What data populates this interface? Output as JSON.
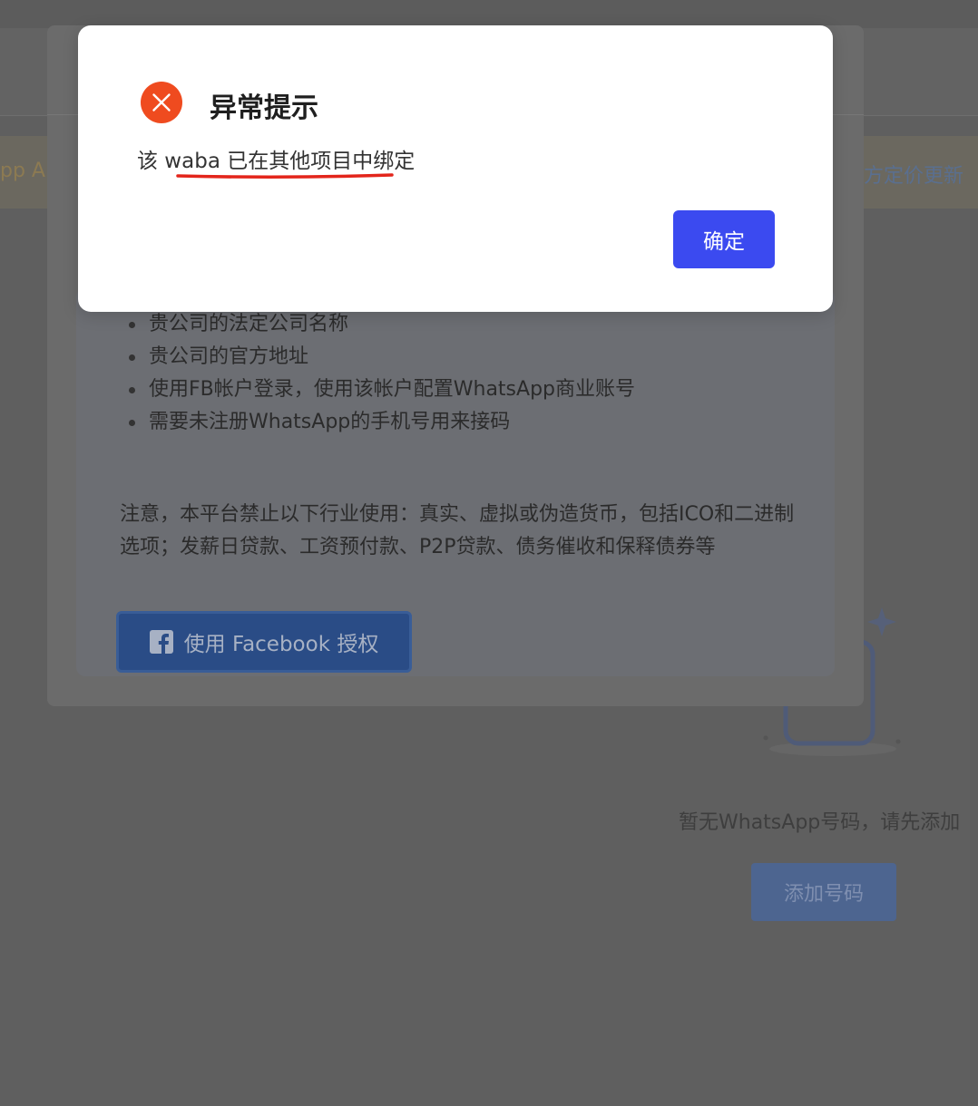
{
  "background": {
    "banner_left_text": "pp A",
    "banner_right_text": "方定价更新",
    "empty_state": {
      "message": "暂无WhatsApp号码，请先添加",
      "add_button_label": "添加号码"
    }
  },
  "setup_modal": {
    "requirements": [
      "贵公司的法定公司名称",
      "贵公司的官方地址",
      "使用FB帐户登录，使用该帐户配置WhatsApp商业账号",
      "需要未注册WhatsApp的手机号用来接码"
    ],
    "notice": "注意，本平台禁止以下行业使用：真实、虚拟或伪造货币，包括ICO和二进制选项；发薪日贷款、工资预付款、P2P贷款、债务催收和保释债券等",
    "facebook_button_label": "使用 Facebook 授权",
    "facebook_icon": "facebook-icon"
  },
  "alert": {
    "icon": "error-x-icon",
    "title": "异常提示",
    "message": "该 waba 已在其他项目中绑定",
    "confirm_label": "确定"
  },
  "colors": {
    "overlay": "#5f5f5f",
    "alert_icon": "#ef4b1f",
    "underline": "#e3251b",
    "confirm": "#3b4af0",
    "facebook_button": "#2a4c86"
  }
}
